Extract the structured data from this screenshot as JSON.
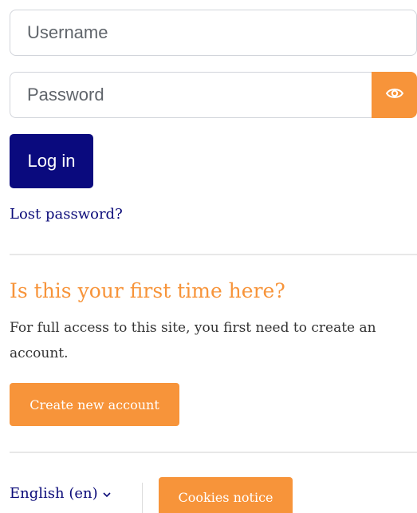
{
  "login_form": {
    "username_placeholder": "Username",
    "password_placeholder": "Password",
    "reveal_password_icon": "eye-icon",
    "login_label": "Log in",
    "lost_password_label": "Lost password?"
  },
  "signup": {
    "heading": "Is this your first time here?",
    "description": "For full access to this site, you first need to create an account.",
    "create_account_label": "Create new account"
  },
  "footer": {
    "language_label": "English (en)",
    "language_chevron_icon": "chevron-down-icon",
    "cookies_label": "Cookies notice"
  },
  "colors": {
    "primary": "#0a0a7e",
    "accent": "#f7943a"
  }
}
